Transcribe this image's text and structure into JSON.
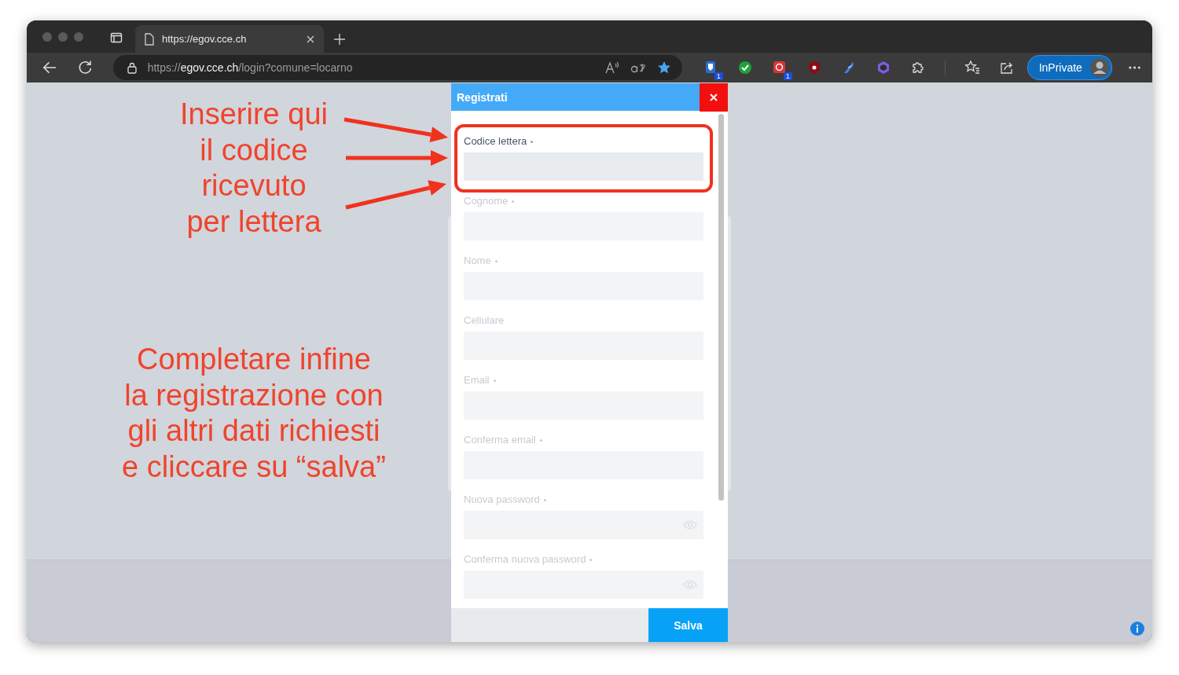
{
  "browser": {
    "tab": {
      "title": "https://egov.cce.ch"
    },
    "address": {
      "scheme": "https://",
      "host": "egov.cce.ch",
      "path": "/login?comune=locarno"
    },
    "extensions": [
      {
        "kind": "shield",
        "badge": "1"
      },
      {
        "kind": "check"
      },
      {
        "kind": "target",
        "badge": "1"
      },
      {
        "kind": "ublock"
      },
      {
        "kind": "feather"
      },
      {
        "kind": "hexagon"
      }
    ],
    "inprivate": "InPrivate"
  },
  "dialog": {
    "title": "Registrati",
    "fields": [
      {
        "label": "Codice lettera",
        "required": true,
        "disabled": false,
        "kind": "text"
      },
      {
        "label": "Cognome",
        "required": true,
        "disabled": true,
        "kind": "text"
      },
      {
        "label": "Nome",
        "required": true,
        "disabled": true,
        "kind": "text"
      },
      {
        "label": "Cellulare",
        "required": false,
        "disabled": true,
        "kind": "text"
      },
      {
        "label": "Email",
        "required": true,
        "disabled": true,
        "kind": "text"
      },
      {
        "label": "Conferma email",
        "required": true,
        "disabled": true,
        "kind": "text"
      },
      {
        "label": "Nuova password",
        "required": true,
        "disabled": true,
        "kind": "password"
      },
      {
        "label": "Conferma nuova password",
        "required": true,
        "disabled": true,
        "kind": "password"
      }
    ],
    "save_button": "Salva"
  },
  "annotations": [
    {
      "text": "Inserire qui\nil codice\nricevuto\nper lettera"
    },
    {
      "text": "Completare infine\nla registrazione con\ngli altri dati richiesti\ne cliccare su “salva”"
    }
  ]
}
